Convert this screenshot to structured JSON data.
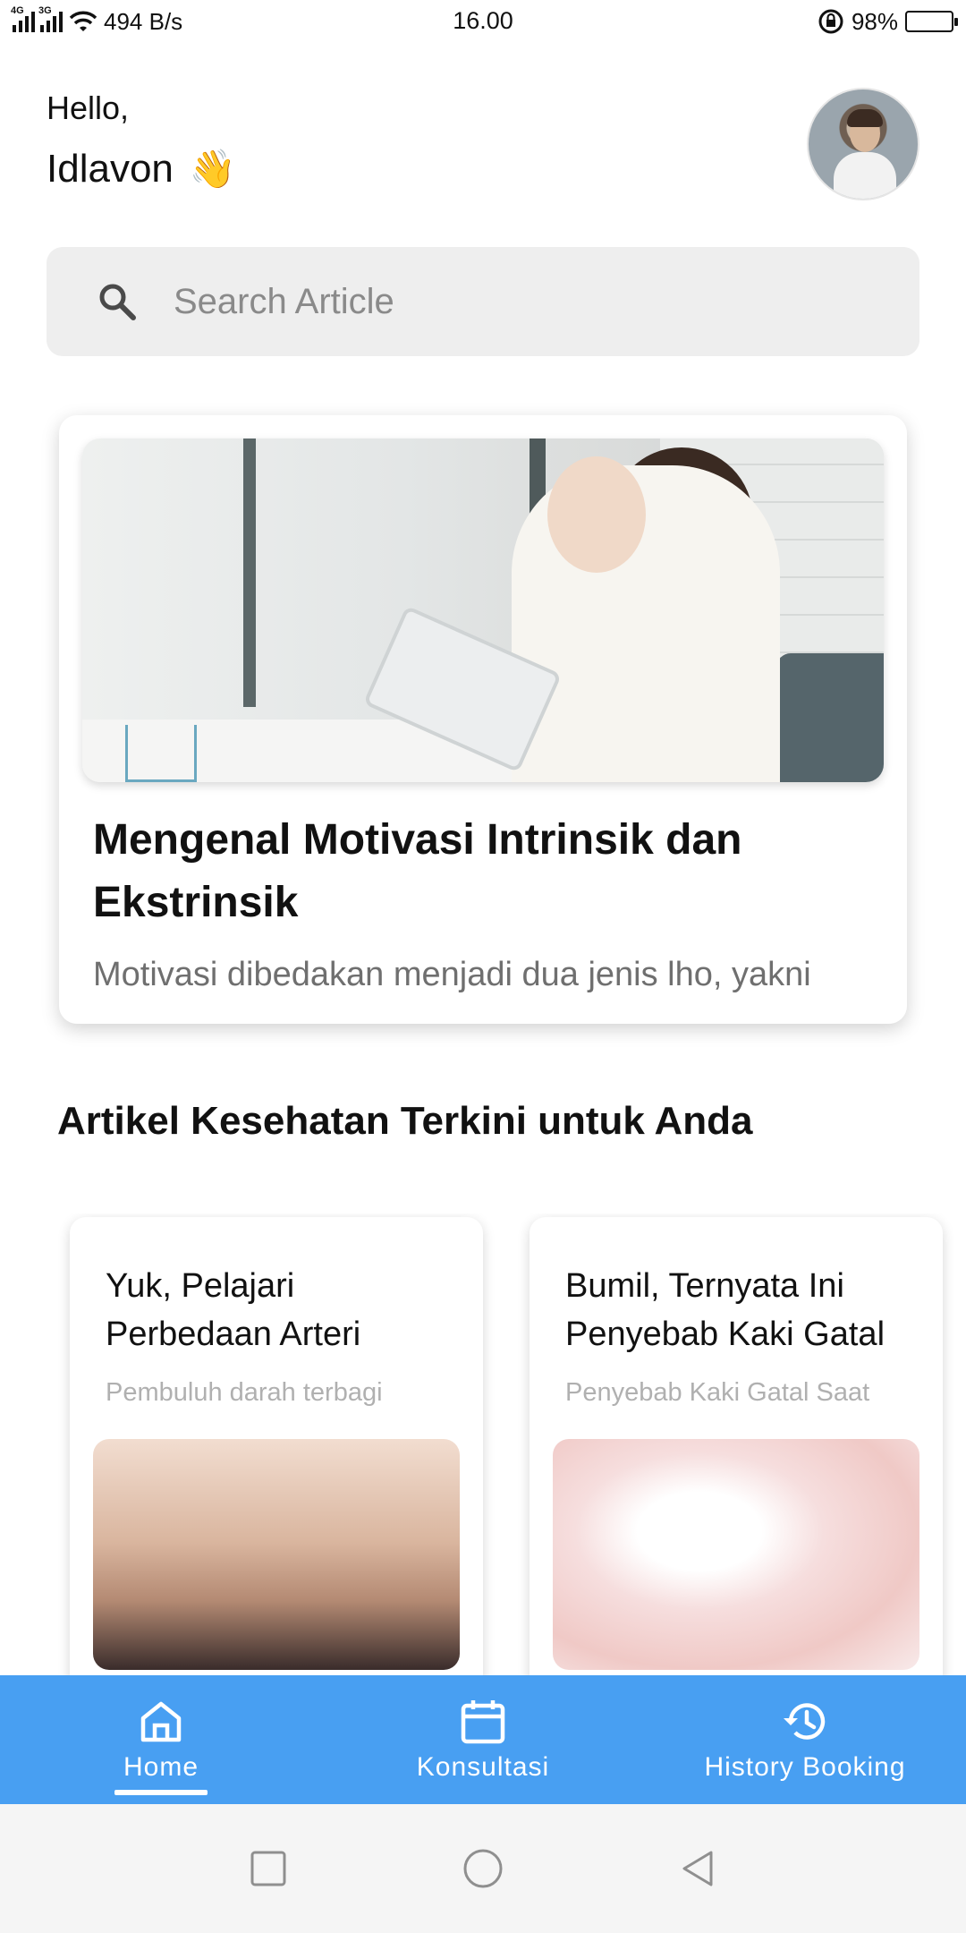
{
  "status_bar": {
    "network_speed": "494 B/s",
    "time": "16.00",
    "battery": "98%",
    "battery_level": 0.98,
    "signal1_tag": "4G",
    "signal2_tag": "3G"
  },
  "greeting": {
    "hello": "Hello,",
    "name": "Idlavon",
    "emoji": "👋"
  },
  "search": {
    "placeholder": "Search Article",
    "icon": "search-icon"
  },
  "featured": {
    "title": "Mengenal Motivasi Intrinsik dan Ekstrinsik",
    "excerpt": "Motivasi dibedakan menjadi dua jenis lho, yakni"
  },
  "section": {
    "title": "Artikel Kesehatan Terkini untuk Anda"
  },
  "articles": [
    {
      "title": "Yuk, Pelajari Perbedaan Arteri",
      "excerpt": "Pembuluh darah terbagi"
    },
    {
      "title": "Bumil, Ternyata Ini Penyebab Kaki Gatal",
      "excerpt": "Penyebab Kaki Gatal Saat"
    }
  ],
  "bottom_nav": {
    "active": "Home",
    "items": [
      {
        "label": "Home",
        "icon": "home-icon"
      },
      {
        "label": "Konsultasi",
        "icon": "calendar-icon"
      },
      {
        "label": "History Booking",
        "icon": "history-icon"
      }
    ]
  },
  "system_nav": {
    "icons": [
      "recents-icon",
      "home-circle-icon",
      "back-icon"
    ]
  },
  "colors": {
    "nav_bg": "#489ff2",
    "search_bg": "#eeeeee"
  }
}
